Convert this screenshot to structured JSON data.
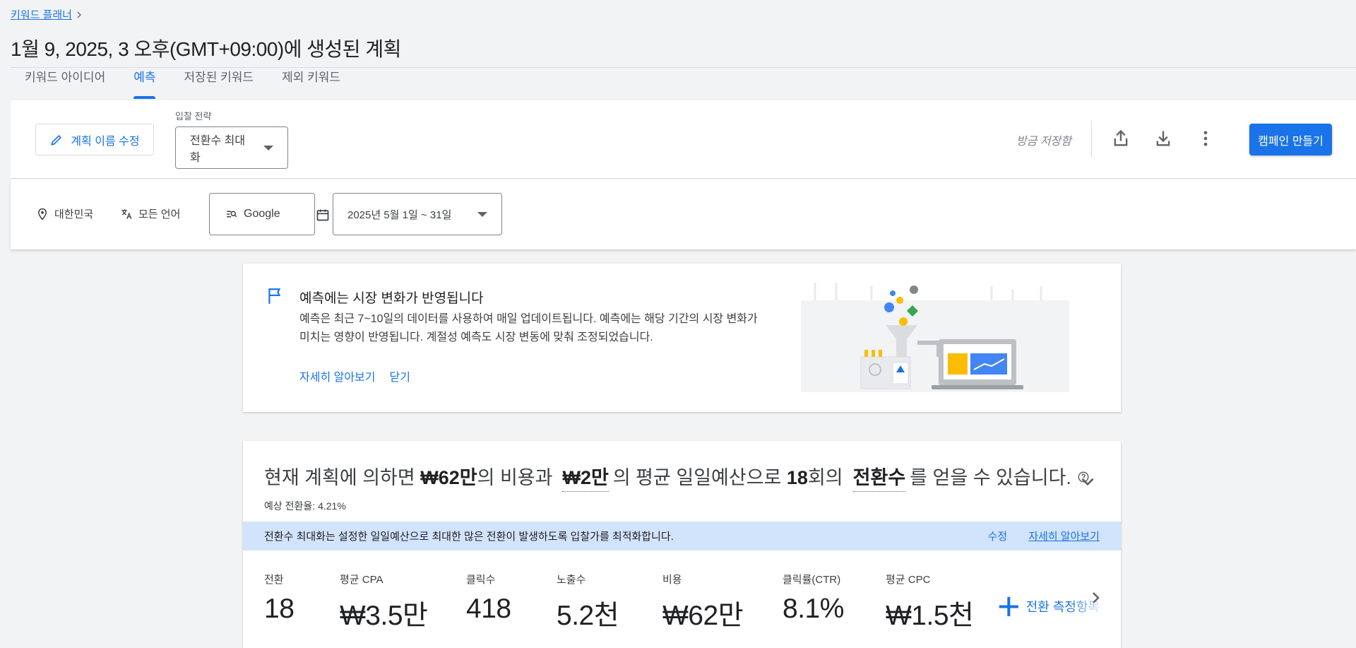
{
  "breadcrumb": {
    "label": "키워드 플래너"
  },
  "page_title": "1월 9, 2025, 3 오후(GMT+09:00)에 생성된 계획",
  "tabs": [
    {
      "label": "키워드 아이디어",
      "active": false
    },
    {
      "label": "예측",
      "active": true
    },
    {
      "label": "저장된 키워드",
      "active": false
    },
    {
      "label": "제외 키워드",
      "active": false
    }
  ],
  "toolbar": {
    "edit_name_label": "계획 이름 수정",
    "bid_strategy_label": "입찰 전략",
    "bid_strategy_value": "전환수 최대화",
    "saved_status": "방금 저장함",
    "icons": [
      "share-icon",
      "download-icon",
      "more-vert-icon",
      "pencil-icon"
    ],
    "create_campaign_label": "캠페인 만들기"
  },
  "filters": {
    "location": "대한민국",
    "language": "모든 언어",
    "network": "Google",
    "date_range": "2025년 5월 1일 ~ 31일",
    "icons": [
      "location-pin-icon",
      "translate-icon",
      "search-network-icon",
      "calendar-icon"
    ]
  },
  "notice": {
    "title": "예측에는 시장 변화가 반영됩니다",
    "body": "예측은 최근 7~10일의 데이터를 사용하여 매일 업데이트됩니다. 예측에는 해당 기간의 시장 변화가 미치는 영향이 반영됩니다. 계절성 예측도 시장 변동에 맞춰 조정되었습니다.",
    "learn_more": "자세히 알아보기",
    "dismiss": "닫기"
  },
  "forecast": {
    "summary": {
      "p1": "현재 계획에 의하면",
      "cost": "₩62만",
      "p2": "의 비용과",
      "budget": "₩2만",
      "p3": "의 평균 일일예산으로",
      "conversions": "18",
      "p4": "회의",
      "metric": "전환수",
      "p5": "를 얻을 수 있습니다."
    },
    "conversion_rate": "예상 전환율: 4.21%",
    "info_text": "전환수 최대화는 설정한 일일예산으로 최대한 많은 전환이 발생하도록 입찰가를 최적화합니다.",
    "info_edit": "수정",
    "info_learn_more": "자세히 알아보기",
    "metrics": [
      {
        "label": "전환",
        "value": "18"
      },
      {
        "label": "평균 CPA",
        "value": "₩3.5만"
      },
      {
        "label": "클릭수",
        "value": "418"
      },
      {
        "label": "노출수",
        "value": "5.2천"
      },
      {
        "label": "비용",
        "value": "₩62만"
      },
      {
        "label": "클릭률(CTR)",
        "value": "8.1%"
      },
      {
        "label": "평균 CPC",
        "value": "₩1.5천"
      }
    ],
    "add_metric_label": "전환 측정항목 추가"
  },
  "colors": {
    "accent": "#1a73e8",
    "background": "#f1f3f4",
    "info_band": "#d2e3fc"
  }
}
